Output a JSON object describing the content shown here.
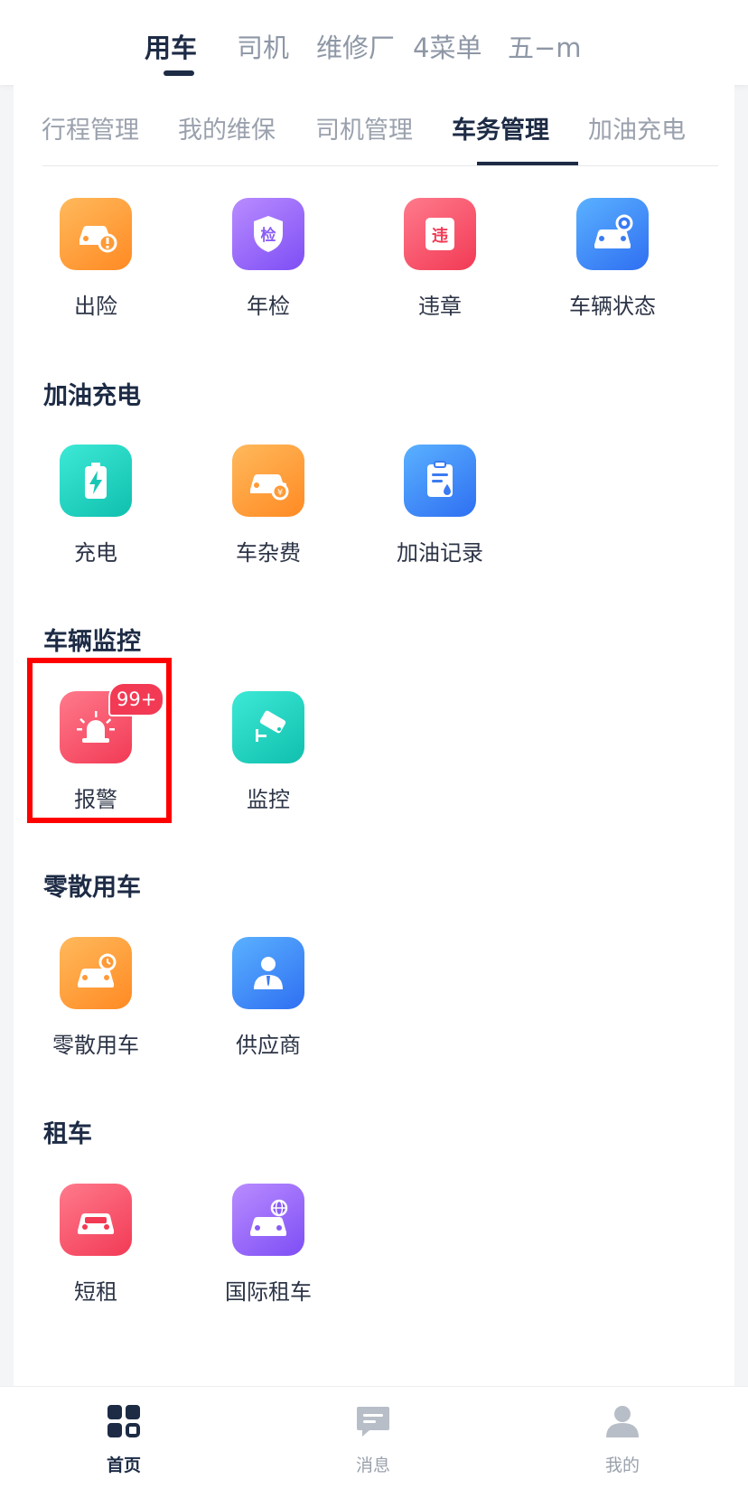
{
  "top_tabs": [
    "用车",
    "司机",
    "维修厂",
    "4菜单",
    "五−m"
  ],
  "sub_tabs": [
    "行程管理",
    "我的维保",
    "司机管理",
    "车务管理",
    "加油充电"
  ],
  "sections": {
    "vehicle_affairs": {
      "items": [
        {
          "label": "出险",
          "icon": "car-accident-icon",
          "color": "orange"
        },
        {
          "label": "年检",
          "icon": "inspection-shield-icon",
          "color": "purple"
        },
        {
          "label": "违章",
          "icon": "violation-icon",
          "color": "red"
        },
        {
          "label": "车辆状态",
          "icon": "car-status-icon",
          "color": "blue"
        }
      ]
    },
    "fuel_charge": {
      "title": "加油充电",
      "items": [
        {
          "label": "充电",
          "icon": "battery-charge-icon",
          "color": "teal"
        },
        {
          "label": "车杂费",
          "icon": "car-fee-icon",
          "color": "orange"
        },
        {
          "label": "加油记录",
          "icon": "fuel-record-icon",
          "color": "blue"
        }
      ]
    },
    "monitoring": {
      "title": "车辆监控",
      "items": [
        {
          "label": "报警",
          "icon": "alarm-siren-icon",
          "color": "red",
          "badge": "99+"
        },
        {
          "label": "监控",
          "icon": "camera-monitor-icon",
          "color": "teal"
        }
      ]
    },
    "scattered": {
      "title": "零散用车",
      "items": [
        {
          "label": "零散用车",
          "icon": "car-clock-icon",
          "color": "orange"
        },
        {
          "label": "供应商",
          "icon": "supplier-person-icon",
          "color": "blue"
        }
      ]
    },
    "rental": {
      "title": "租车",
      "items": [
        {
          "label": "短租",
          "icon": "short-rent-car-icon",
          "color": "red"
        },
        {
          "label": "国际租车",
          "icon": "global-car-icon",
          "color": "purple"
        }
      ]
    }
  },
  "bottom_nav": [
    {
      "label": "首页",
      "icon": "home-grid-icon"
    },
    {
      "label": "消息",
      "icon": "message-icon"
    },
    {
      "label": "我的",
      "icon": "profile-icon"
    }
  ],
  "colors": {
    "active_text": "#1d2b45",
    "inactive_text": "#8e97a6",
    "highlight": "#ff0000",
    "badge": "#f23a55"
  }
}
